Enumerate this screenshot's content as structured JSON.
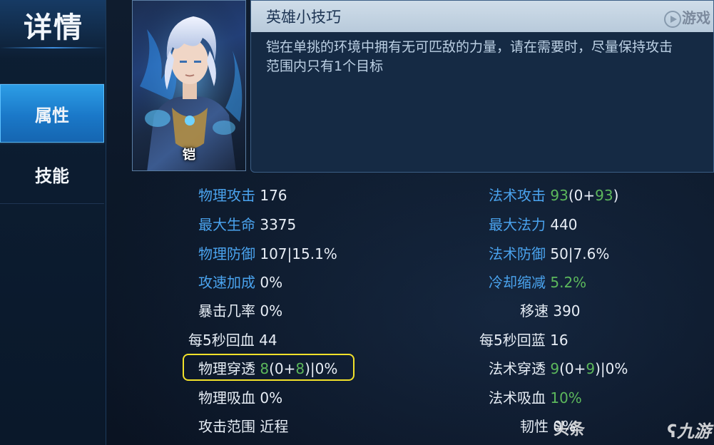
{
  "nav": {
    "title": "详情",
    "items": [
      {
        "label": "属性",
        "active": true
      },
      {
        "label": "技能",
        "active": false
      }
    ]
  },
  "hero": {
    "name": "铠"
  },
  "tip": {
    "title": "英雄小技巧",
    "text": "铠在单挑的环境中拥有无可匹敌的力量，请在需要时，尽量保持攻击范围内只有1个目标"
  },
  "stats_left": [
    {
      "label": "物理攻击",
      "value": "176"
    },
    {
      "label": "最大生命",
      "value": "3375"
    },
    {
      "label": "物理防御",
      "value": "107|15.1%"
    },
    {
      "label": "攻速加成",
      "value": "0%"
    },
    {
      "label": "暴击几率",
      "value": "0%"
    },
    {
      "label": "每5秒回血",
      "value": "44"
    },
    {
      "label": "物理穿透",
      "value_green": "8",
      "value_mid": "(0+",
      "value_green2": "8",
      "value_tail": ")|0%"
    },
    {
      "label": "物理吸血",
      "value": "0%"
    },
    {
      "label": "攻击范围",
      "value": "近程"
    }
  ],
  "stats_right": [
    {
      "label": "法术攻击",
      "value_green": "93",
      "value_mid": "(0+",
      "value_green2": "93",
      "value_tail": ")"
    },
    {
      "label": "最大法力",
      "value": "440"
    },
    {
      "label": "法术防御",
      "value": "50|7.6%"
    },
    {
      "label": "冷却缩减",
      "value_green": "5.2%"
    },
    {
      "label": "移速",
      "value": "390"
    },
    {
      "label": "每5秒回蓝",
      "value": "16"
    },
    {
      "label": "法术穿透",
      "value_green": "9",
      "value_mid": "(0+",
      "value_green2": "9",
      "value_tail": ")|0%"
    },
    {
      "label": "法术吸血",
      "value_green": "10%"
    },
    {
      "label": "韧性",
      "value": "0%"
    }
  ],
  "watermarks": {
    "top": "游戏",
    "toutiao": "头条",
    "bottom": "九游"
  },
  "colors": {
    "accent_blue": "#4aa3ee",
    "green": "#5cb85c",
    "highlight": "#f2e12a",
    "nav_active": "#1f86d6"
  }
}
